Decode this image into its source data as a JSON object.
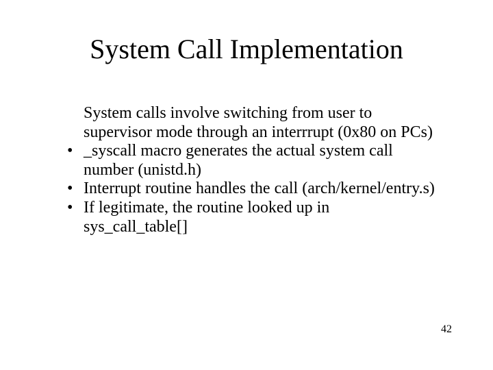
{
  "title": "System Call Implementation",
  "items": [
    {
      "bullet": "",
      "text": "System calls involve switching from user to supervisor mode through an interrrupt (0x80 on PCs)"
    },
    {
      "bullet": "•",
      "text": "_syscall macro generates the actual system call number (unistd.h)"
    },
    {
      "bullet": "•",
      "text": "Interrupt routine handles the call (arch/kernel/entry.s)"
    },
    {
      "bullet": "•",
      "text": "If legitimate, the routine looked up in sys_call_table[]"
    }
  ],
  "page_number": "42"
}
